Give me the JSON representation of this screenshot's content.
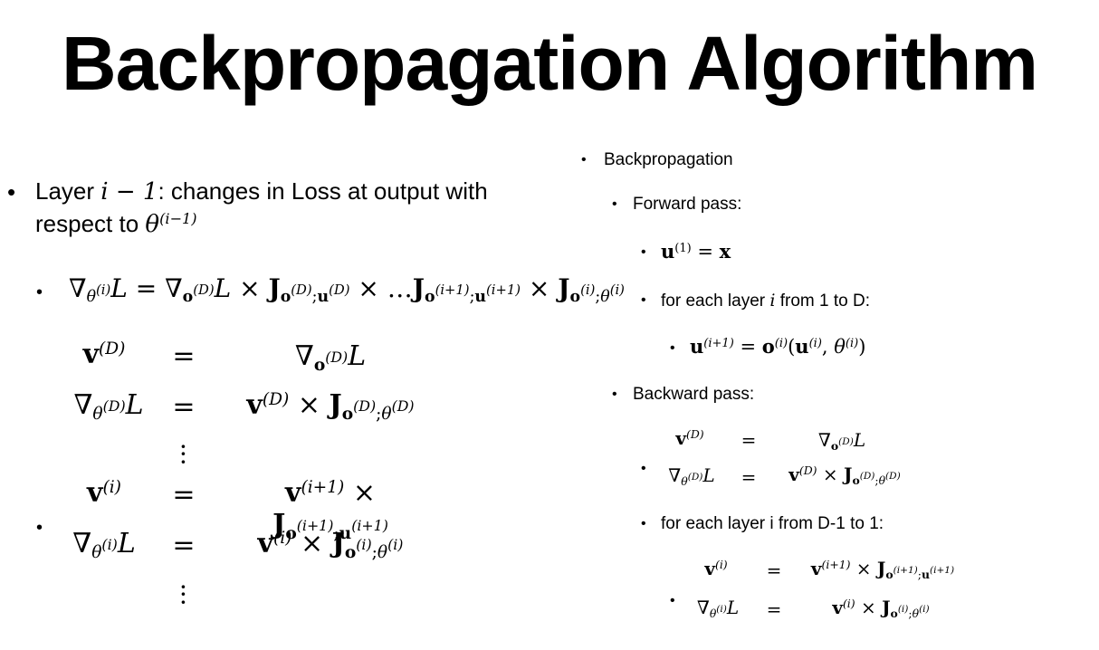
{
  "title": "Backpropagation Algorithm",
  "left": {
    "layer_line1_pre": "Layer ",
    "layer_math": "i − 1",
    "layer_line1_post": ": changes in Loss at output with",
    "layer_line2_pre": "respect to ",
    "layer_line2_math": "θ",
    "layer_line2_sup": "(i−1)",
    "bullet_char": "•"
  },
  "right": {
    "backprop": "Backpropagation",
    "forward_pass": "Forward pass:",
    "for_each_layer_forward_pre": "for each layer ",
    "for_each_layer_forward_var": "i",
    "for_each_layer_forward_post": " from 1 to D:",
    "backward_pass": "Backward pass:",
    "for_each_layer_backward": "for each layer i from D-1 to 1:"
  }
}
